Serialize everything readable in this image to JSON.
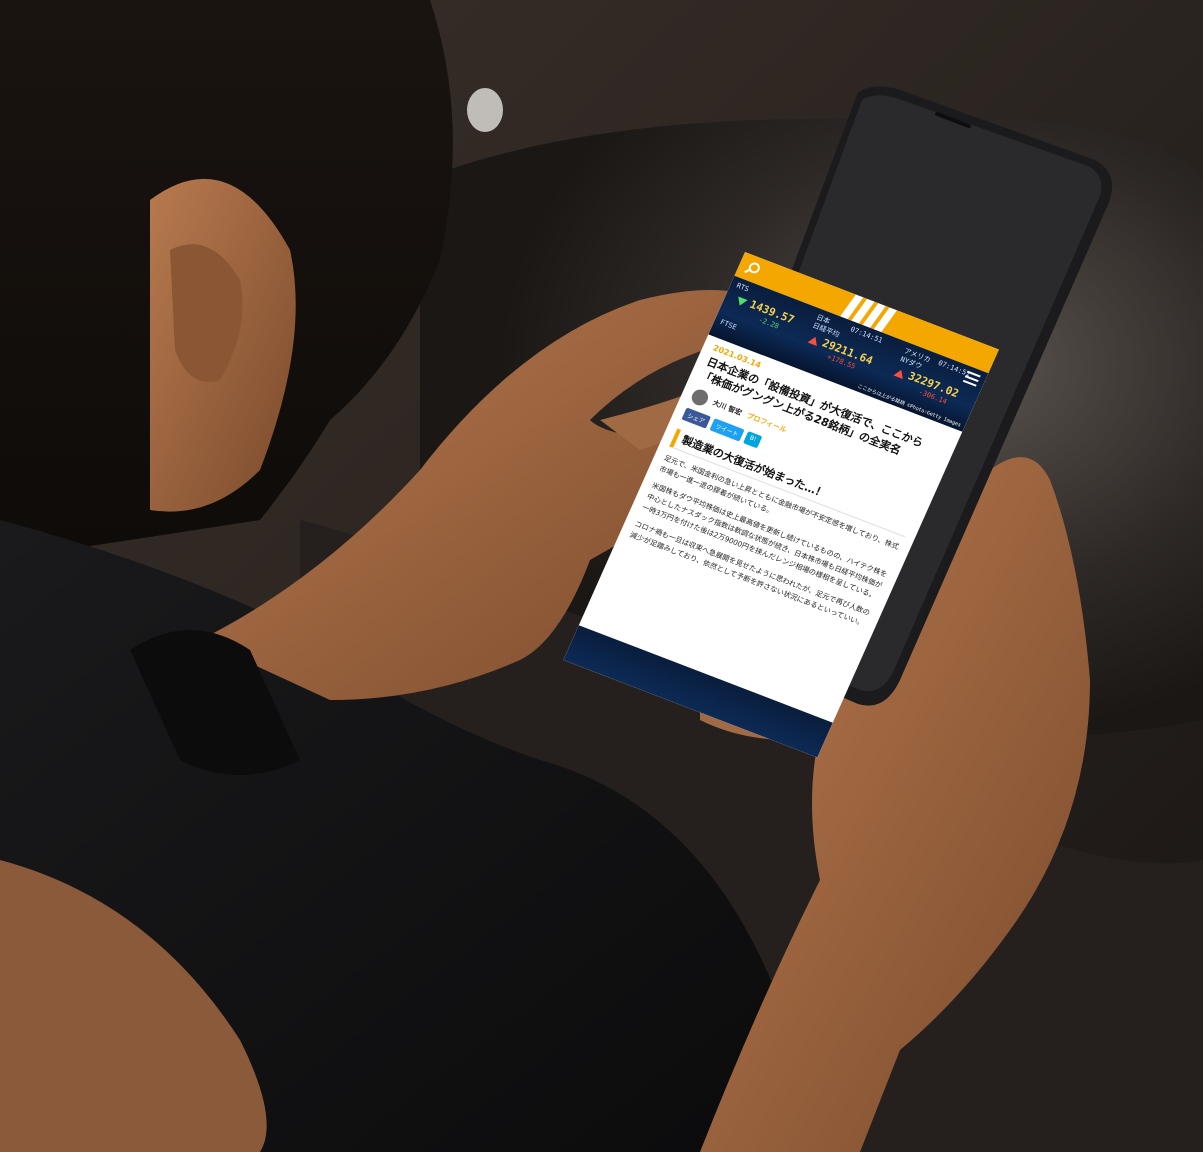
{
  "ticker": {
    "rts_label": "RTS",
    "rts_value": "1439.57",
    "rts_change": "-2.28",
    "fx_label": "FTSE",
    "nikkei_region": "日本",
    "nikkei_label": "日経平均",
    "nikkei_time": "07:14:51",
    "nikkei_value": "29211.64",
    "nikkei_change": "+178.55",
    "ny_region": "アメリカ",
    "ny_label": "NYダウ",
    "ny_time": "07:14:51",
    "ny_value": "32297.02",
    "ny_change": "-306.14",
    "credit": "ここからは上がる銘柄 ©Photo:Getty Images"
  },
  "article": {
    "date": "2021.03.14",
    "headline": "日本企業の「設備投資」が大復活で、ここから「株価がグングン上がる28銘柄」の全実名",
    "author": "大川 智宏",
    "profile_link": "プロフィール",
    "share_fb": "シェア",
    "share_tw": "ツイート",
    "share_hb": "B!",
    "section_title": "製造業の大復活が始まった…！",
    "para1": "足元で、米国金利の急い上昇とともに金融市場が不安定感を増しており、株式市場も一進一退の膠着が続いている。",
    "para2": "米国株もダウ平均株価は史上最高値を更新し続けているものの、ハイテク株を中心としたナスダック指数は軟調な状態が続き、日本株市場も日経平均株価が一時3万円を付けた後は2万9000円を挟んだレンジ相場の様相を呈している。",
    "para3": "コロナ禍も一旦は収束へ急展開を見せたように思われたが、足元で再び人数の減少が足踏みしており、依然として予断を許さない状況にあるといっていい。"
  }
}
